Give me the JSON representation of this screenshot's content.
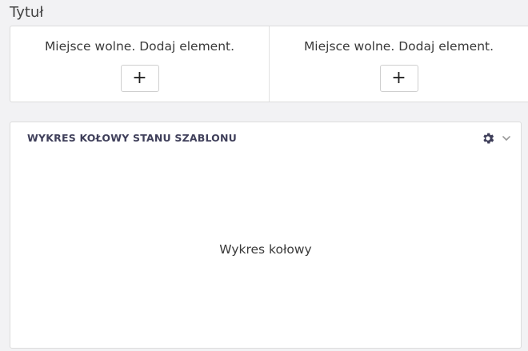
{
  "page": {
    "title": "Tytuł"
  },
  "slots": [
    {
      "text": "Miejsce wolne. Dodaj element.",
      "button_label": "+"
    },
    {
      "text": "Miejsce wolne. Dodaj element.",
      "button_label": "+"
    }
  ],
  "widget": {
    "title": "WYKRES KOŁOWY STANU SZABLONU",
    "body_text": "Wykres kołowy",
    "icons": [
      "gear-icon",
      "chevron-down-icon"
    ]
  },
  "colors": {
    "background": "#f2f2f4",
    "panel": "#ffffff",
    "border": "#dcdcdc",
    "title_text": "#3f3f5a"
  }
}
